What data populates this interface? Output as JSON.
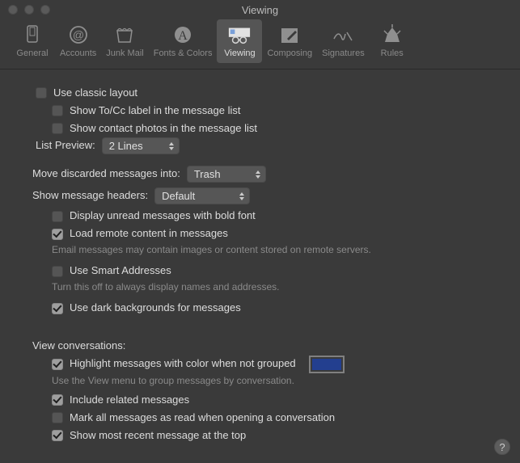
{
  "window": {
    "title": "Viewing"
  },
  "toolbar": {
    "items": [
      {
        "label": "General"
      },
      {
        "label": "Accounts"
      },
      {
        "label": "Junk Mail"
      },
      {
        "label": "Fonts & Colors"
      },
      {
        "label": "Viewing"
      },
      {
        "label": "Composing"
      },
      {
        "label": "Signatures"
      },
      {
        "label": "Rules"
      }
    ],
    "selected": "Viewing"
  },
  "layout": {
    "classic": "Use classic layout",
    "show_tocc": "Show To/Cc label in the message list",
    "show_photos": "Show contact photos in the message list",
    "list_preview_label": "List Preview:",
    "list_preview_value": "2 Lines"
  },
  "move_discarded": {
    "label": "Move discarded messages into:",
    "value": "Trash"
  },
  "headers": {
    "label": "Show message headers:",
    "value": "Default"
  },
  "options": {
    "bold_unread": "Display unread messages with bold font",
    "remote": "Load remote content in messages",
    "remote_sub": "Email messages may contain images or content stored on remote servers.",
    "smart": "Use Smart Addresses",
    "smart_sub": "Turn this off to always display names and addresses.",
    "dark_bg": "Use dark backgrounds for messages"
  },
  "conversations": {
    "heading": "View conversations:",
    "highlight": "Highlight messages with color when not grouped",
    "highlight_sub": "Use the View menu to group messages by conversation.",
    "highlight_color": "#233f8f",
    "include_related": "Include related messages",
    "mark_all_read": "Mark all messages as read when opening a conversation",
    "recent_top": "Show most recent message at the top"
  },
  "help": "?"
}
